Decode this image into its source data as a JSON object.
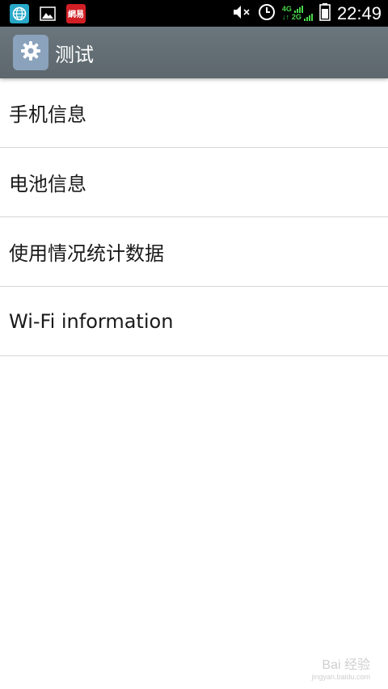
{
  "status_bar": {
    "time": "22:49",
    "network_top": "4G",
    "network_bottom": "2G",
    "icons": [
      "browser-app-icon",
      "gallery-icon",
      "netease-news-icon",
      "mute-icon",
      "alarm-clock-icon",
      "signal-icon",
      "battery-icon"
    ],
    "news_icon_text": "網易"
  },
  "action_bar": {
    "title": "测试",
    "icon": "gear-icon"
  },
  "menu": {
    "items": [
      {
        "label": "手机信息"
      },
      {
        "label": "电池信息"
      },
      {
        "label": "使用情况统计数据"
      },
      {
        "label": "Wi-Fi information"
      }
    ]
  },
  "watermark": {
    "brand": "Bai 经验",
    "url": "jingyan.baidu.com"
  },
  "colors": {
    "status_bar": "#000000",
    "action_bar": "#636e74",
    "app_icon_bg": "#8ba2bd",
    "signal_green": "#49d64a",
    "divider": "#d6d6d6"
  }
}
